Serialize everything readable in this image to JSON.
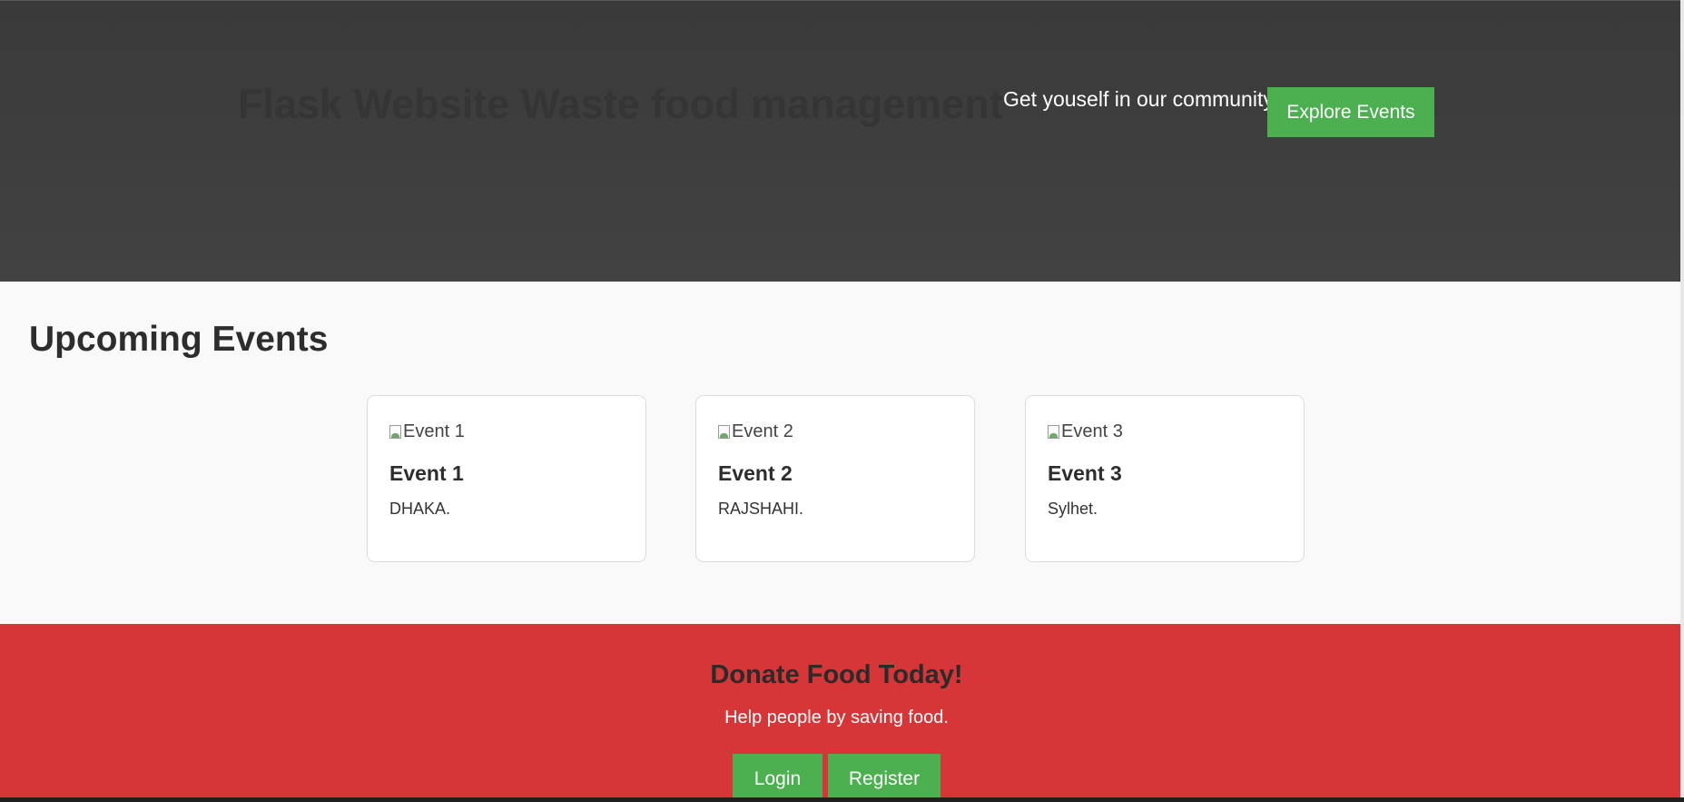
{
  "hero": {
    "title": "Flask Website Waste food management",
    "tagline": "Get youself in our community",
    "explore_label": "Explore Events"
  },
  "events": {
    "heading": "Upcoming Events",
    "cards": [
      {
        "img_alt": "Event 1",
        "name": "Event 1",
        "location": "DHAKA."
      },
      {
        "img_alt": "Event 2",
        "name": "Event 2",
        "location": "RAJSHAHI."
      },
      {
        "img_alt": "Event 3",
        "name": "Event 3",
        "location": "Sylhet."
      }
    ]
  },
  "donate": {
    "heading": "Donate Food Today!",
    "text": "Help people by saving food.",
    "login_label": "Login",
    "register_label": "Register"
  },
  "colors": {
    "hero_bg": "#3e3e3e",
    "accent_green": "#4caf50",
    "donate_red": "#d63638"
  }
}
